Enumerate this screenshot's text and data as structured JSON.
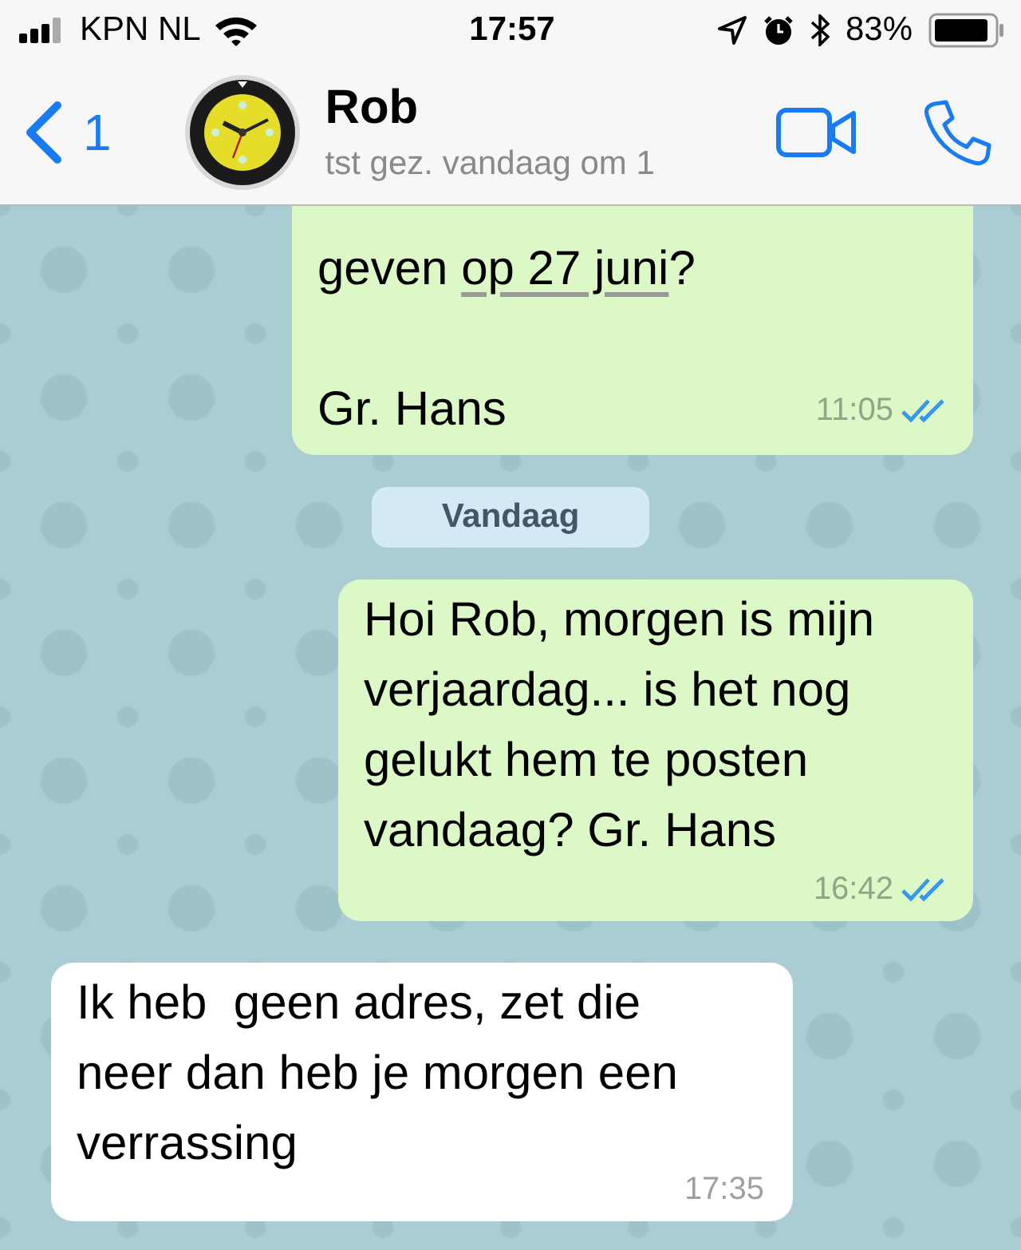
{
  "status_bar": {
    "carrier": "KPN NL",
    "time": "17:57",
    "battery": "83%"
  },
  "header": {
    "back_count": "1",
    "name": "Rob",
    "subtitle": "tst gez. vandaag om 1"
  },
  "chat": [
    {
      "kind": "outgoing",
      "cut_top": true,
      "segments": [
        {
          "text": "geven "
        },
        {
          "text": "op 27 juni",
          "link": true
        },
        {
          "text": "?\n\nGr. Hans"
        }
      ],
      "time": "11:05",
      "read": true
    },
    {
      "kind": "date",
      "label": "Vandaag"
    },
    {
      "kind": "outgoing",
      "segments": [
        {
          "text": "Hoi Rob, morgen is mijn verjaardag... is het nog gelukt hem te posten vandaag? Gr. Hans"
        }
      ],
      "time": "16:42",
      "read": true
    },
    {
      "kind": "incoming",
      "segments": [
        {
          "text": "Ik heb  geen adres, zet die neer dan heb je morgen een verrassing"
        }
      ],
      "time": "17:35"
    }
  ]
}
